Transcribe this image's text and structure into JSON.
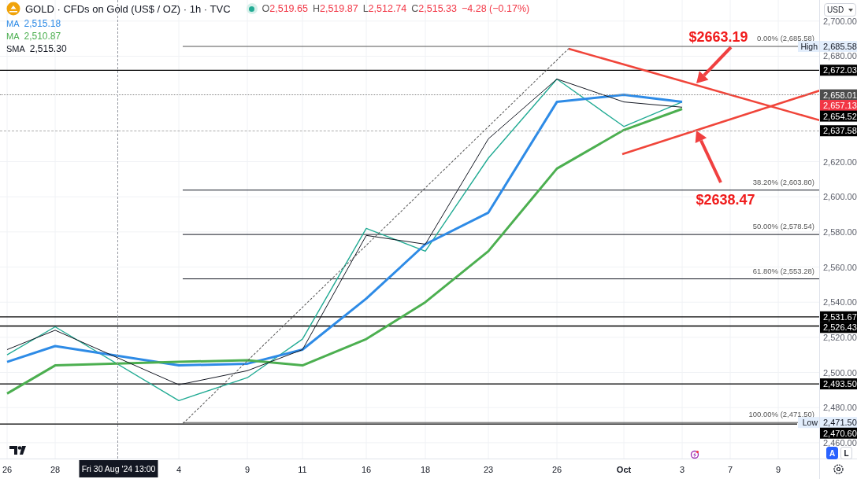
{
  "header": {
    "symbol": "GOLD · CFDs on Gold (US$ / OZ) · 1h · TVC",
    "market_open": true,
    "down": true,
    "ohlc": [
      {
        "label": "O",
        "value": "2,519.65"
      },
      {
        "label": "H",
        "value": "2,519.87"
      },
      {
        "label": "L",
        "value": "2,512.74"
      },
      {
        "label": "C",
        "value": "2,515.33"
      }
    ],
    "change": "−4.28 (−0.17%)",
    "indicator_values": [
      "2,515.18",
      "2,510.87",
      "2,515.30"
    ]
  },
  "currency": "USD",
  "scale_buttons": [
    {
      "label": "A",
      "selected": true
    },
    {
      "label": "L",
      "selected": false
    }
  ],
  "chart_data": {
    "type": "line",
    "categories": [
      "26",
      "28",
      "4",
      "9",
      "11",
      "16",
      "18",
      "23",
      "26",
      "Oct",
      "3",
      "7",
      "9"
    ],
    "series": [
      {
        "color": "#22ab94",
        "values": [
          2510,
          2526,
          2484,
          2497,
          2519,
          2582,
          2569,
          2622,
          2667,
          2640,
          2654,
          null,
          null
        ]
      },
      {
        "name": "MA",
        "color": "#2e8be6",
        "values": [
          2506,
          2515,
          2504,
          2505,
          2513,
          2542,
          2573,
          2591,
          2654,
          2658,
          2654,
          null,
          null
        ]
      },
      {
        "name": "MA",
        "color": "#4caf50",
        "values": [
          2488,
          2504,
          2506,
          2507,
          2504,
          2519,
          2540,
          2569,
          2616,
          2638,
          2650,
          null,
          null
        ]
      },
      {
        "name": "SMA",
        "color": "#131722",
        "values": [
          2513,
          2524,
          2493,
          2501,
          2513,
          2578,
          2573,
          2633,
          2667,
          2654,
          2651,
          null,
          null
        ]
      }
    ],
    "ylim": [
      2451,
      2712
    ],
    "grid": true,
    "yticks": [
      {
        "value": 2700,
        "label": "2,700.00"
      },
      {
        "value": 2680,
        "label": "2,680.00"
      },
      {
        "value": 2620,
        "label": "2,620.00"
      },
      {
        "value": 2600,
        "label": "2,600.00"
      },
      {
        "value": 2580,
        "label": "2,580.00"
      },
      {
        "value": 2560,
        "label": "2,560.00"
      },
      {
        "value": 2540,
        "label": "2,540.00"
      },
      {
        "value": 2520,
        "label": "2,520.00"
      },
      {
        "value": 2500,
        "label": "2,500.00"
      },
      {
        "value": 2480,
        "label": "2,480.00"
      },
      {
        "value": 2460,
        "label": "2,460.00"
      }
    ]
  },
  "fib_levels": [
    {
      "label": "0.00% (2,685.58)",
      "tag": "High",
      "axis_label": "2,685.58"
    },
    {
      "label": "38.20% (2,603.80)"
    },
    {
      "label": "50.00% (2,578.54)"
    },
    {
      "label": "61.80% (2,553.28)"
    },
    {
      "label": "100.00% (2,471.50)",
      "tag": "Low",
      "axis_label": "2,471.50"
    }
  ],
  "price_lines": [
    {
      "kind": "solid",
      "axis_label": "2,672.03",
      "color": "#000000"
    },
    {
      "kind": "dotted",
      "axis_label": "2,658.01",
      "color": "#4d4d4d"
    },
    {
      "kind": "marker",
      "axis_label": "2,657.13",
      "color": "#f23645"
    },
    {
      "kind": "marker",
      "axis_label": "2,654.52",
      "color": "#000000"
    },
    {
      "kind": "dashed",
      "axis_label": "2,637.58",
      "color": "#000000"
    },
    {
      "kind": "solid",
      "axis_label": "2,531.67",
      "color": "#000000"
    },
    {
      "kind": "solid",
      "axis_label": "2,526.43",
      "color": "#000000"
    },
    {
      "kind": "solid",
      "axis_label": "2,493.50",
      "color": "#000000"
    },
    {
      "kind": "solid",
      "axis_label": "2,470.60",
      "color": "#000000"
    }
  ],
  "callouts": [
    {
      "label": "$2663.19"
    },
    {
      "label": "$2638.47"
    }
  ],
  "crosshair": {
    "time_label": "Fri 30 Aug '24  13:00"
  }
}
